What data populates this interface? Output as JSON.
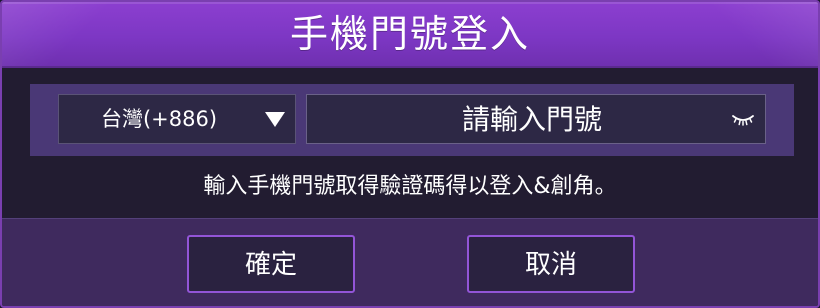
{
  "dialog": {
    "title": "手機門號登入"
  },
  "form": {
    "country_code": "台灣(+886)",
    "phone_placeholder": "請輸入門號",
    "phone_value": "",
    "eye_icon": "closed-eye-icon"
  },
  "hint": "輸入手機門號取得驗證碼得以登入&創角。",
  "buttons": {
    "confirm_label": "確定",
    "cancel_label": "取消"
  },
  "colors": {
    "title_bar": "#8c3fd0",
    "button_border": "#9355d8",
    "input_row": "#4a3876",
    "footer": "#3f2a5e"
  }
}
